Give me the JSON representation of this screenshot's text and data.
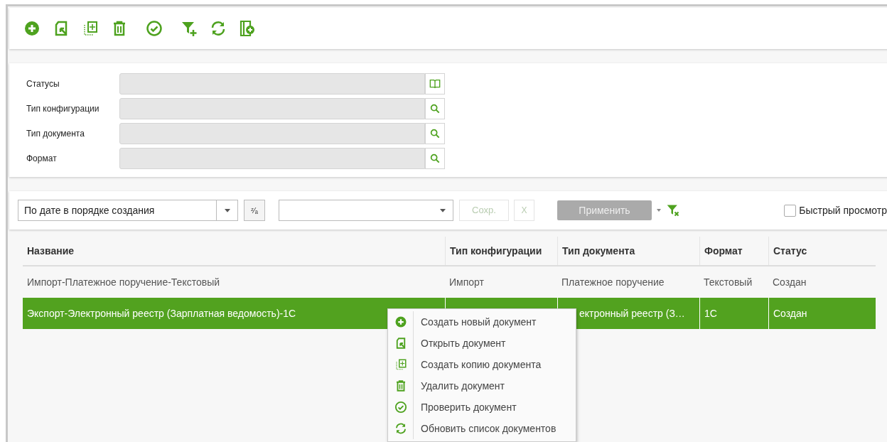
{
  "toolbar": [
    {
      "kind": "add"
    },
    {
      "kind": "open"
    },
    {
      "kind": "copy"
    },
    {
      "kind": "delete"
    },
    {
      "kind": "check"
    },
    {
      "kind": "filter-add"
    },
    {
      "kind": "refresh"
    },
    {
      "kind": "doc-add"
    }
  ],
  "filters": [
    {
      "label": "Статусы",
      "kind": "book"
    },
    {
      "label": "Тип конфигурации",
      "kind": "search"
    },
    {
      "label": "Тип документа",
      "kind": "search"
    },
    {
      "label": "Формат",
      "kind": "search"
    }
  ],
  "sort_bar": {
    "sort": "По дате в порядке создания",
    "sort_direction": "ᶻ⁄ₐ",
    "save": {
      "label": "Сохр.",
      "disabled": true
    },
    "clear": {
      "label": "X",
      "disabled": true
    },
    "apply": {
      "label": "Применить",
      "disabled": true
    },
    "quick_view": {
      "label": "Быстрый просмотр",
      "checked": false
    }
  },
  "table": {
    "columns": [
      "Название",
      "Тип конфигурации",
      "Тип документа",
      "Формат",
      "Статус"
    ],
    "rows": [
      {
        "selected": false,
        "cells": [
          "Импорт-Платежное поручение-Текстовый",
          "Импорт",
          "Платежное поручение",
          "Текстовый",
          "Создан"
        ]
      },
      {
        "selected": true,
        "cells": [
          "Экспорт-Электронный реестр (Зарплатная ведомость)-1С",
          null,
          "ектронный реестр (З…",
          "1С",
          "Создан"
        ]
      }
    ]
  },
  "context_menu": [
    {
      "kind": "add",
      "label": "Создать новый документ"
    },
    {
      "kind": "open",
      "label": "Открыть документ"
    },
    {
      "kind": "copy",
      "label": "Создать копию документа"
    },
    {
      "kind": "delete",
      "label": "Удалить документ"
    },
    {
      "kind": "check",
      "label": "Проверить документ"
    },
    {
      "kind": "refresh",
      "label": "Обновить список документов"
    }
  ]
}
